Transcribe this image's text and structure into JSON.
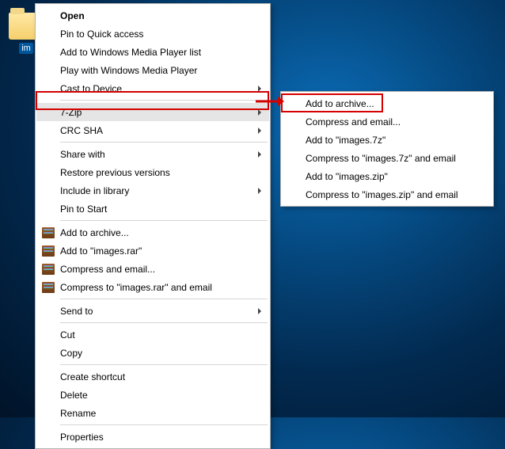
{
  "desktop": {
    "folder_label": "im"
  },
  "main_menu": {
    "open": "Open",
    "pin_quick": "Pin to Quick access",
    "add_wmp_list": "Add to Windows Media Player list",
    "play_wmp": "Play with Windows Media Player",
    "cast": "Cast to Device",
    "sevenzip": "7-Zip",
    "crc_sha": "CRC SHA",
    "share_with": "Share with",
    "restore_prev": "Restore previous versions",
    "include_lib": "Include in library",
    "pin_start": "Pin to Start",
    "add_archive": "Add to archive...",
    "add_images_rar": "Add to \"images.rar\"",
    "compress_email": "Compress and email...",
    "compress_images_rar_email": "Compress to \"images.rar\" and email",
    "send_to": "Send to",
    "cut": "Cut",
    "copy": "Copy",
    "create_shortcut": "Create shortcut",
    "delete": "Delete",
    "rename": "Rename",
    "properties": "Properties"
  },
  "sub_menu": {
    "add_archive": "Add to archive...",
    "compress_email": "Compress and email...",
    "add_images_7z": "Add to \"images.7z\"",
    "compress_images_7z_email": "Compress to \"images.7z\" and email",
    "add_images_zip": "Add to \"images.zip\"",
    "compress_images_zip_email": "Compress to \"images.zip\" and email"
  }
}
